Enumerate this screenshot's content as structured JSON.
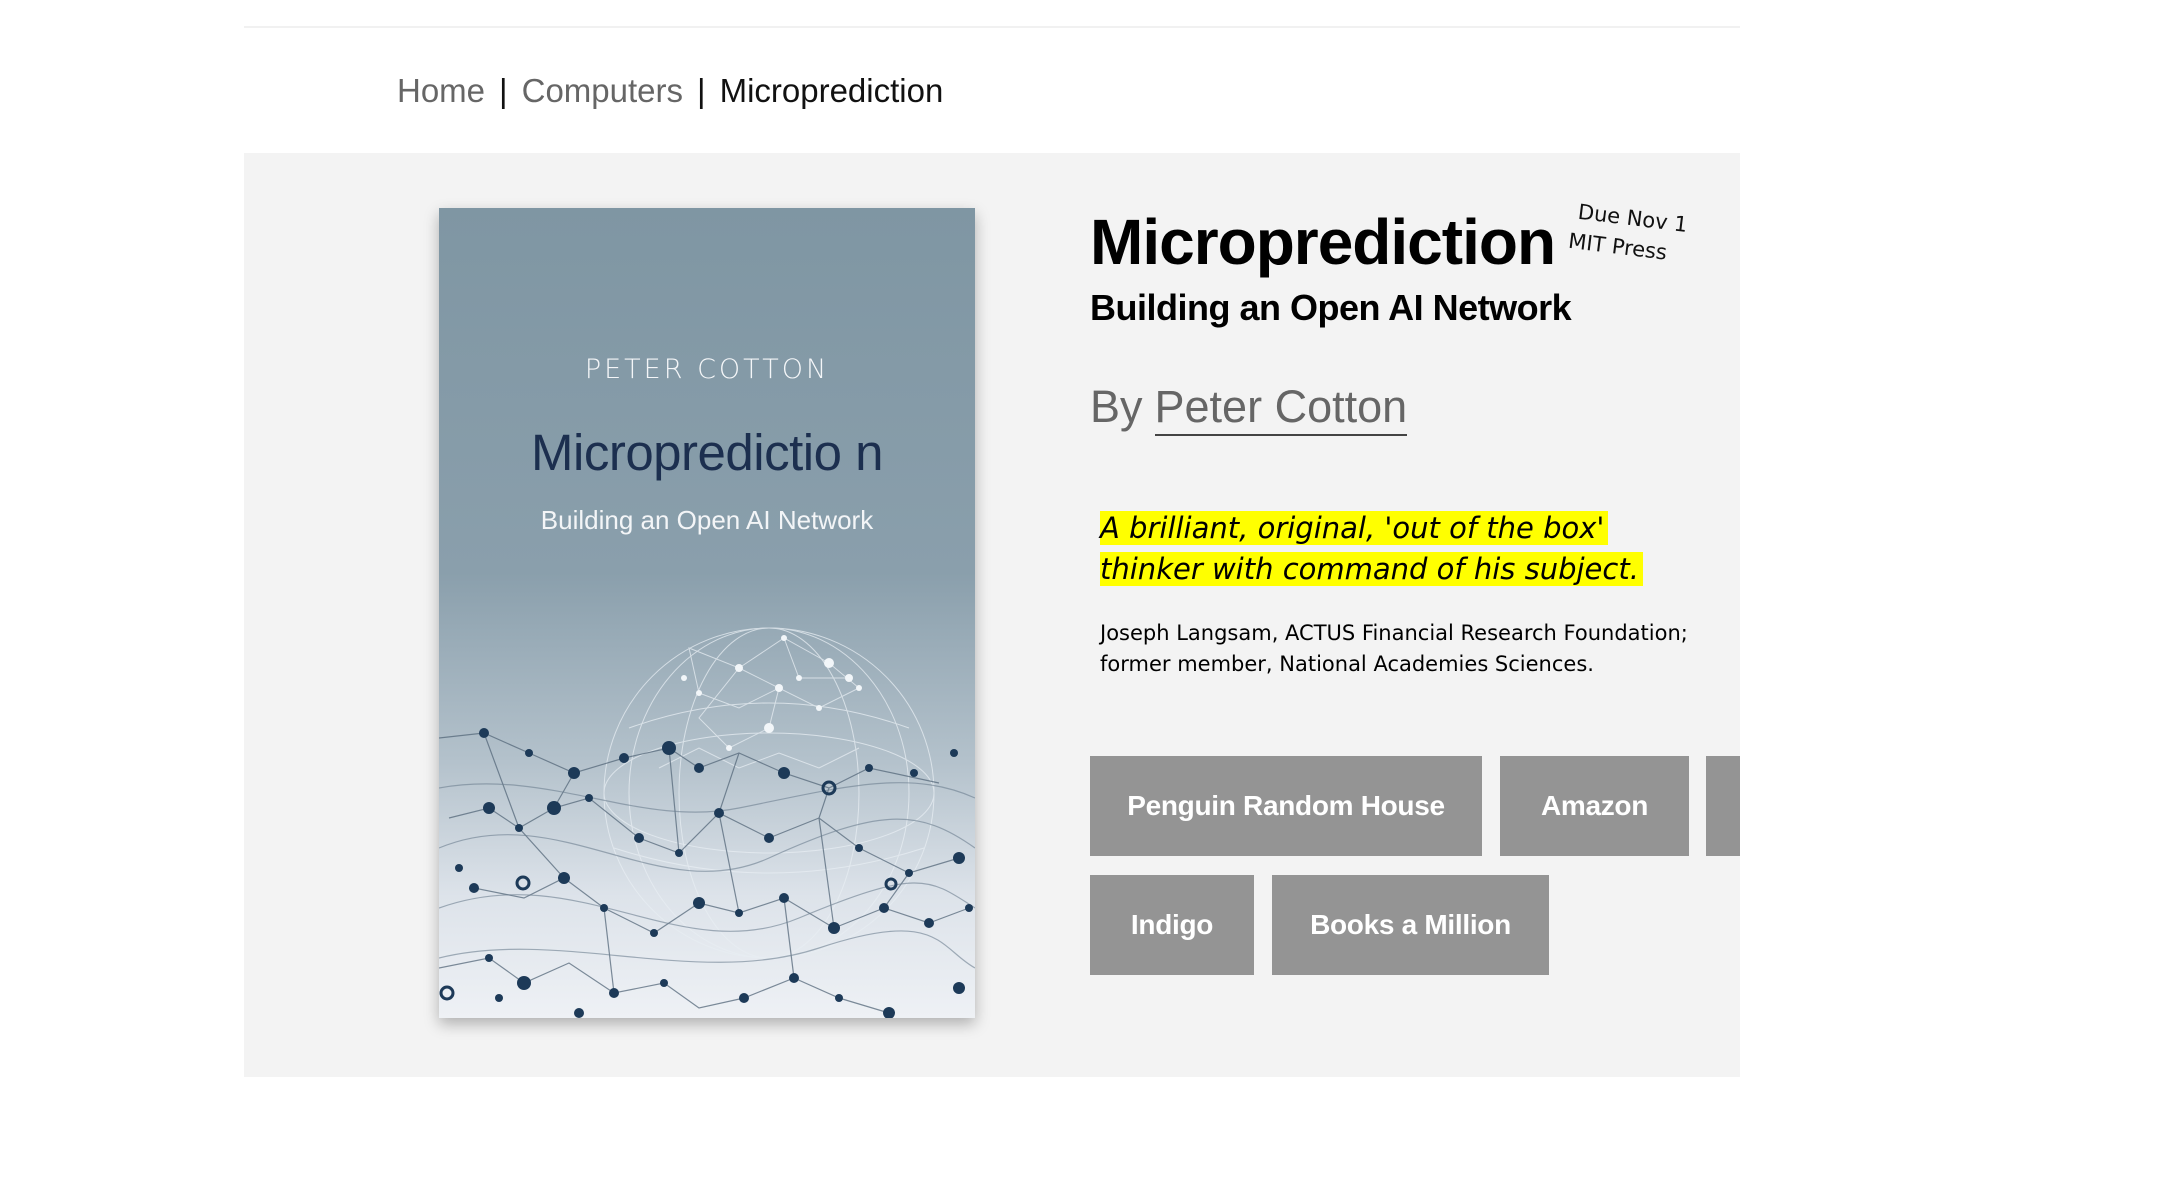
{
  "breadcrumb": {
    "items": [
      {
        "label": "Home"
      },
      {
        "label": "Computers"
      },
      {
        "label": "Microprediction"
      }
    ],
    "separator": "|"
  },
  "cover": {
    "author": "PETER COTTON",
    "title": "Micropredictio n",
    "subtitle": "Building an Open AI Network"
  },
  "book": {
    "title": "Microprediction",
    "subtitle": "Building an Open AI Network",
    "by_prefix": "By",
    "author": "Peter Cotton"
  },
  "note": {
    "line1": "Due Nov 1",
    "line2": "MIT Press"
  },
  "quote": {
    "text": "A brilliant, original, 'out of the box' thinker with command of his subject.",
    "attribution": "Joseph Langsam, ACTUS Financial Research Foundation; former member, National Academies Sciences."
  },
  "retailers": {
    "penguin": "Penguin Random House",
    "amazon": "Amazon",
    "indigo": "Indigo",
    "books_a_million": "Books a Million"
  },
  "colors": {
    "panel_bg": "#f3f3f3",
    "button_bg": "#949494",
    "highlight": "#ffff00",
    "cover_title": "#1c2f4f"
  }
}
